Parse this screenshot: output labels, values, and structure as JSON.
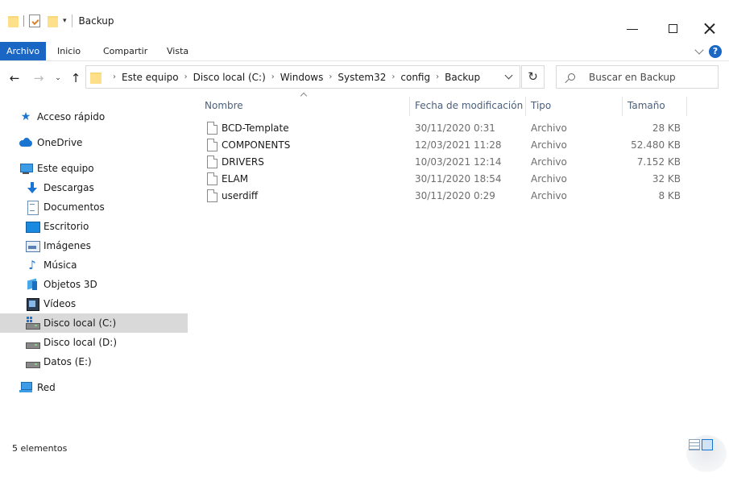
{
  "window": {
    "title": "Backup"
  },
  "ribbon": {
    "tabs": [
      "Archivo",
      "Inicio",
      "Compartir",
      "Vista"
    ],
    "help": "?"
  },
  "nav": {
    "breadcrumbs": [
      "Este equipo",
      "Disco local (C:)",
      "Windows",
      "System32",
      "config",
      "Backup"
    ],
    "search_placeholder": "Buscar en Backup"
  },
  "sidebar": {
    "items": [
      {
        "label": "Acceso rápido",
        "icon": "star-icon"
      },
      {
        "label": "OneDrive",
        "icon": "cloud-icon"
      },
      {
        "label": "Este equipo",
        "icon": "computer-icon"
      },
      {
        "label": "Descargas",
        "icon": "download-icon"
      },
      {
        "label": "Documentos",
        "icon": "documents-icon"
      },
      {
        "label": "Escritorio",
        "icon": "desktop-icon"
      },
      {
        "label": "Imágenes",
        "icon": "pictures-icon"
      },
      {
        "label": "Música",
        "icon": "music-icon"
      },
      {
        "label": "Objetos 3D",
        "icon": "objects-3d-icon"
      },
      {
        "label": "Vídeos",
        "icon": "videos-icon"
      },
      {
        "label": "Disco local (C:)",
        "icon": "drive-icon",
        "selected": true
      },
      {
        "label": "Disco local (D:)",
        "icon": "drive-icon"
      },
      {
        "label": "Datos (E:)",
        "icon": "drive-icon"
      },
      {
        "label": "Red",
        "icon": "network-icon"
      }
    ]
  },
  "columns": {
    "name": "Nombre",
    "date": "Fecha de modificación",
    "type": "Tipo",
    "size": "Tamaño"
  },
  "files": [
    {
      "name": "BCD-Template",
      "date": "30/11/2020 0:31",
      "type": "Archivo",
      "size": "28 KB"
    },
    {
      "name": "COMPONENTS",
      "date": "12/03/2021 11:28",
      "type": "Archivo",
      "size": "52.480 KB"
    },
    {
      "name": "DRIVERS",
      "date": "10/03/2021 12:14",
      "type": "Archivo",
      "size": "7.152 KB"
    },
    {
      "name": "ELAM",
      "date": "30/11/2020 18:54",
      "type": "Archivo",
      "size": "32 KB"
    },
    {
      "name": "userdiff",
      "date": "30/11/2020 0:29",
      "type": "Archivo",
      "size": "8 KB"
    }
  ],
  "status": {
    "count": "5 elementos"
  },
  "colors": {
    "accent": "#1a66c4",
    "selected_bg": "#d9d9d9",
    "folder": "#f8d775"
  }
}
